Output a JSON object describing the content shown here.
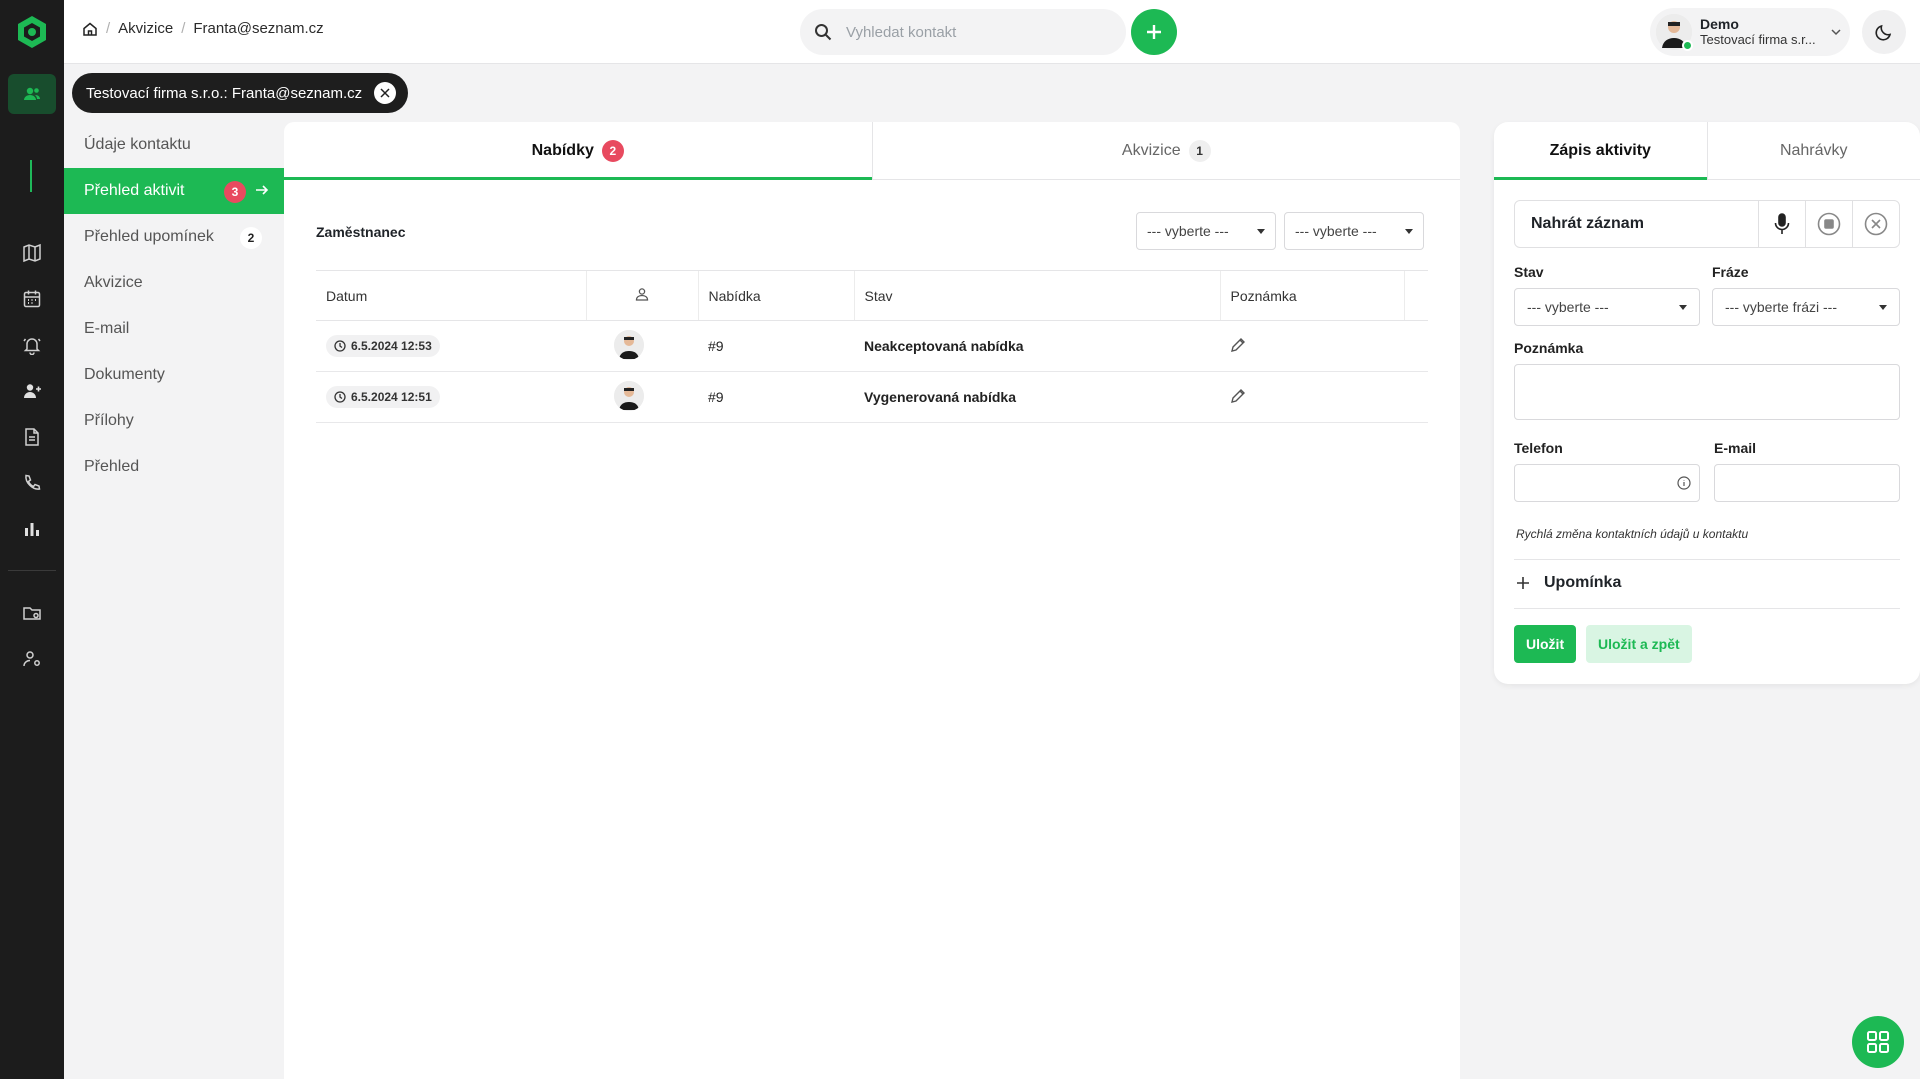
{
  "breadcrumb": {
    "items": [
      "Akvizice",
      "Franta@seznam.cz"
    ]
  },
  "search": {
    "placeholder": "Vyhledat kontakt"
  },
  "user": {
    "name": "Demo",
    "company": "Testovací firma s.r..."
  },
  "chip": {
    "label": "Testovací firma s.r.o.: Franta@seznam.cz"
  },
  "leftnav": {
    "items": [
      {
        "label": "Údaje kontaktu"
      },
      {
        "label": "Přehled aktivit",
        "badge": "3"
      },
      {
        "label": "Přehled upomínek",
        "badge": "2"
      },
      {
        "label": "Akvizice"
      },
      {
        "label": "E-mail"
      },
      {
        "label": "Dokumenty"
      },
      {
        "label": "Přílohy"
      },
      {
        "label": "Přehled"
      }
    ]
  },
  "main": {
    "tabs": [
      {
        "label": "Nabídky",
        "badge": "2"
      },
      {
        "label": "Akvizice",
        "badge": "1"
      }
    ],
    "filter_label": "Zaměstnanec",
    "filter_selects": [
      "--- vyberte ---",
      "--- vyberte ---"
    ],
    "columns": [
      "Datum",
      "",
      "Nabídka",
      "Stav",
      "Poznámka"
    ],
    "rows": [
      {
        "date": "6.5.2024 12:53",
        "offer": "#9",
        "state": "Neakceptovaná nabídka"
      },
      {
        "date": "6.5.2024 12:51",
        "offer": "#9",
        "state": "Vygenerovaná nabídka"
      }
    ]
  },
  "right": {
    "tabs": [
      "Zápis aktivity",
      "Nahrávky"
    ],
    "record_label": "Nahrát záznam",
    "stav_label": "Stav",
    "stav_value": "--- vyberte ---",
    "fraze_label": "Fráze",
    "fraze_value": "--- vyberte frázi ---",
    "note_label": "Poznámka",
    "phone_label": "Telefon",
    "email_label": "E-mail",
    "hint": "Rychlá změna kontaktních údajů u kontaktu",
    "reminder_label": "Upomínka",
    "save_label": "Uložit",
    "save_back_label": "Uložit a zpět"
  },
  "colors": {
    "accent": "#1db954",
    "badge_red": "#e84a5f",
    "sidebar": "#1c1c1c"
  }
}
